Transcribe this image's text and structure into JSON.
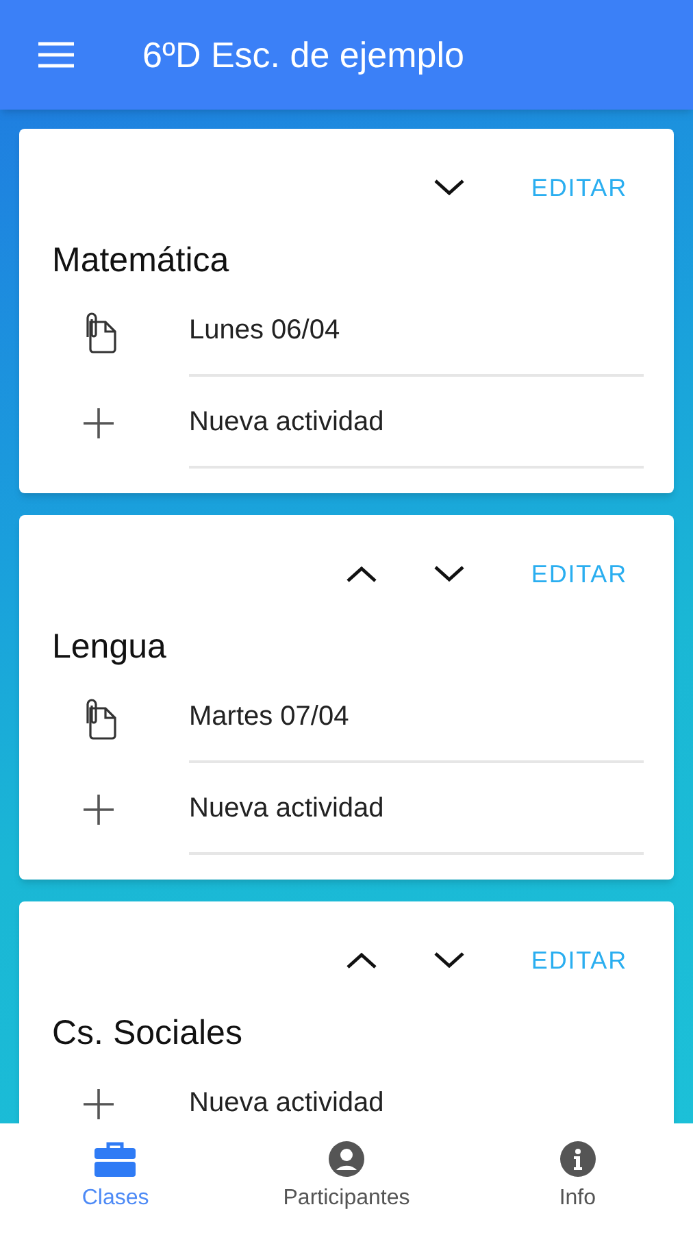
{
  "app_bar": {
    "title": "6ºD Esc. de ejemplo"
  },
  "classes": [
    {
      "name": "Matemática",
      "can_move_up": false,
      "can_move_down": true,
      "edit_label": "EDITAR",
      "items": [
        {
          "kind": "activity",
          "label": "Lunes 06/04"
        },
        {
          "kind": "add",
          "label": "Nueva actividad"
        }
      ]
    },
    {
      "name": "Lengua",
      "can_move_up": true,
      "can_move_down": true,
      "edit_label": "EDITAR",
      "items": [
        {
          "kind": "activity",
          "label": "Martes 07/04"
        },
        {
          "kind": "add",
          "label": "Nueva actividad"
        }
      ]
    },
    {
      "name": "Cs. Sociales",
      "can_move_up": true,
      "can_move_down": true,
      "edit_label": "EDITAR",
      "items": [
        {
          "kind": "add",
          "label": "Nueva actividad"
        }
      ]
    }
  ],
  "bottom_nav": [
    {
      "kind": "classes",
      "label": "Clases",
      "selected": true
    },
    {
      "kind": "participants",
      "label": "Participantes",
      "selected": false
    },
    {
      "kind": "info",
      "label": "Info",
      "selected": false
    }
  ]
}
